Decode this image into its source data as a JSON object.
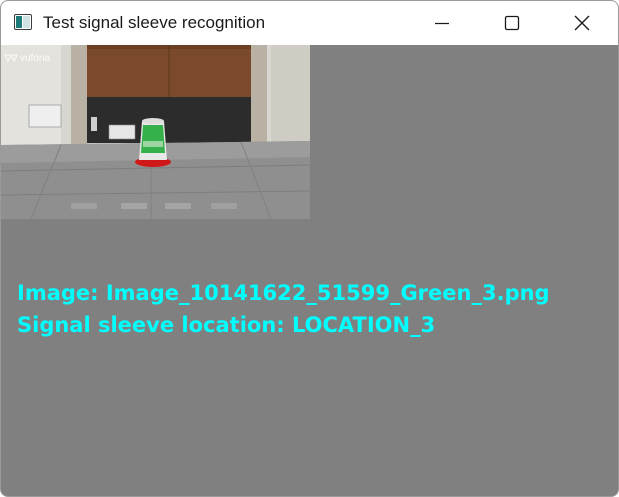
{
  "window": {
    "title": "Test signal sleeve recognition",
    "controls": [
      "minimize-icon",
      "maximize-icon",
      "close-icon"
    ]
  },
  "camera_view": {
    "watermark": "vuforia"
  },
  "overlay": {
    "image_line": "Image: Image_10141622_51599_Green_3.png",
    "location_line": "Signal sleeve location: LOCATION_3",
    "text_color": "#00ffff"
  },
  "colors": {
    "background": "#808080",
    "titlebar": "#ffffff"
  }
}
